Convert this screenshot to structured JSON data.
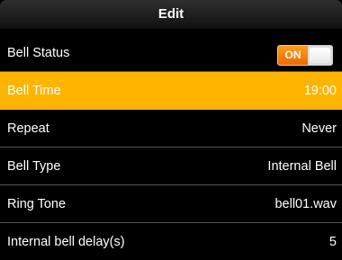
{
  "header": {
    "title": "Edit"
  },
  "toggle_on_label": "ON",
  "rows": [
    {
      "label": "Bell Status",
      "value": ""
    },
    {
      "label": "Bell Time",
      "value": "19:00"
    },
    {
      "label": "Repeat",
      "value": "Never"
    },
    {
      "label": "Bell Type",
      "value": "Internal Bell"
    },
    {
      "label": "Ring Tone",
      "value": "bell01.wav"
    },
    {
      "label": "Internal bell delay(s)",
      "value": "5"
    }
  ],
  "colors": {
    "selected_row": "#ffb400",
    "toggle_on": "#f08000",
    "background": "#000000"
  }
}
